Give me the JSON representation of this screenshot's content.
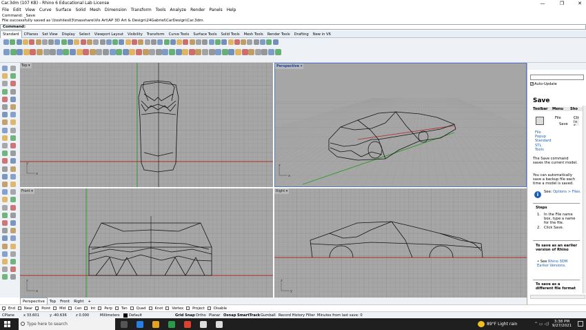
{
  "window": {
    "title": "Car.3dm (107 KB) - Rhino 6 Educational Lab License",
    "minimize": "—",
    "maximize": "❐",
    "close": "✕"
  },
  "menu": [
    "File",
    "Edit",
    "View",
    "Curve",
    "Surface",
    "Solid",
    "Mesh",
    "Dimension",
    "Transform",
    "Tools",
    "Analyze",
    "Render",
    "Panels",
    "Help"
  ],
  "command_history": [
    "Command: _Save",
    "File successfully saved as \\\\toshiles03\\masshare\\Vis Art\\AP 3D Art & Design\\24Gabriel\\CarDesign\\Car.3dm."
  ],
  "command_prompt": "Command:",
  "toolbar_tabs": [
    "Standard",
    "CPlanes",
    "Set View",
    "Display",
    "Select",
    "Viewport Layout",
    "Visibility",
    "Transform",
    "Curve Tools",
    "Surface Tools",
    "Solid Tools",
    "Mesh Tools",
    "Render Tools",
    "Drafting",
    "New in V6"
  ],
  "viewports": {
    "top": {
      "label": "Top ▾"
    },
    "perspective": {
      "label": "Perspective ▾"
    },
    "front": {
      "label": "Front ▾"
    },
    "right": {
      "label": "Right ▾"
    }
  },
  "axis_labels": {
    "x": "x",
    "y": "y",
    "z": "z"
  },
  "viewport_tabs": [
    "Perspective",
    "Top",
    "Front",
    "Right",
    "+"
  ],
  "right_panel": {
    "auto_update": "Auto-Update",
    "title": "Save",
    "table_headers": [
      "Toolbar",
      "Menu",
      "Sho"
    ],
    "menu_file": "File",
    "menu_save": "Save",
    "shortcut": "Ctrl+S",
    "toolbar_locations": [
      "File",
      "Popup",
      "Standard",
      "STL",
      "Tools"
    ],
    "desc1": "The Save command saves the current model.",
    "desc2": "You can automatically save a backup file each time a model is saved.",
    "see_prefix": "See: ",
    "see_link": "Options > Files.",
    "steps_heading": "Steps",
    "steps": [
      "In the File name box, type a name for the file.",
      "Click Save."
    ],
    "section2": "To save as an earlier version of Rhino",
    "section2_prefix": "See ",
    "section2_link": "Rhino 3DM Earlier Versions.",
    "section3": "To save as a different file format"
  },
  "osnaps": [
    {
      "label": "End",
      "checked": true
    },
    {
      "label": "Near",
      "checked": false
    },
    {
      "label": "Point",
      "checked": true
    },
    {
      "label": "Mid",
      "checked": false
    },
    {
      "label": "Cen",
      "checked": false
    },
    {
      "label": "Int",
      "checked": false
    },
    {
      "label": "Perp",
      "checked": false
    },
    {
      "label": "Tan",
      "checked": false
    },
    {
      "label": "Quad",
      "checked": false
    },
    {
      "label": "Knot",
      "checked": false
    },
    {
      "label": "Vertex",
      "checked": false
    },
    {
      "label": "Project",
      "checked": false
    },
    {
      "label": "Disable",
      "checked": false
    }
  ],
  "status": {
    "cplane": "CPlane",
    "x": "x 33.601",
    "y": "y -40.636",
    "z": "z 0.000",
    "units": "Millimeters",
    "layer": "Default",
    "grid_snap": "Grid Snap",
    "ortho": "Ortho",
    "planar": "Planar",
    "osnap": "Osnap",
    "smarttrack": "SmartTrack",
    "gumball": "Gumball",
    "record": "Record History",
    "filter": "Filter",
    "save_msg": "Minutes from last save: 0"
  },
  "taskbar": {
    "search": "Type here to search",
    "weather": "89°F  Light rain",
    "time": "3:38 PM",
    "date": "9/27/2021"
  },
  "colors": {
    "grid_bg": "#a6a6a6",
    "grid_line": "#9a9a9a",
    "grid_major": "#8c8c8c",
    "x_axis": "#b02a2a",
    "y_axis": "#2a9a2a",
    "accent": "#1a5fb4"
  }
}
